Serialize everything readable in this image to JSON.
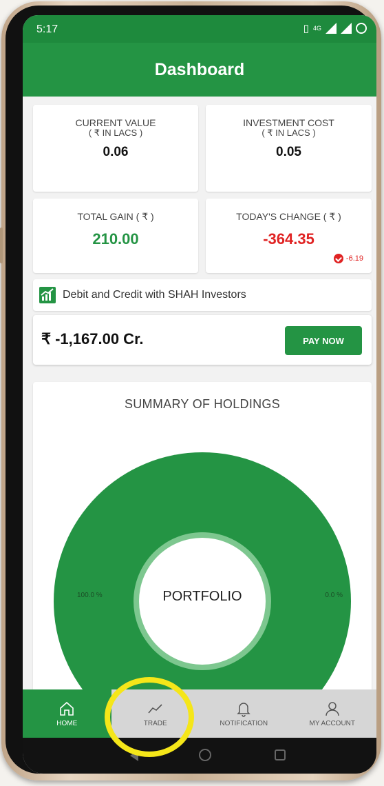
{
  "status_bar": {
    "time": "5:17",
    "network": "4G"
  },
  "header": {
    "title": "Dashboard"
  },
  "cards": {
    "current_value": {
      "label": "CURRENT VALUE",
      "sub": "( ₹ IN LACS )",
      "value": "0.06"
    },
    "investment_cost": {
      "label": "INVESTMENT COST",
      "sub": "( ₹ IN LACS )",
      "value": "0.05"
    },
    "total_gain": {
      "label": "TOTAL GAIN ( ₹ )",
      "value": "210.00"
    },
    "todays_change": {
      "label": "TODAY'S CHANGE ( ₹ )",
      "value": "-364.35",
      "change": "-6.19"
    }
  },
  "debit": {
    "text": "Debit and Credit with SHAH Investors"
  },
  "payment": {
    "balance": "₹ -1,167.00 Cr.",
    "pay_label": "PAY NOW"
  },
  "summary": {
    "title": "SUMMARY OF HOLDINGS",
    "center_label": "PORTFOLIO",
    "left_percent": "100.0 %",
    "right_percent": "0.0 %"
  },
  "nav": {
    "items": [
      {
        "label": "HOME",
        "icon": "home-icon",
        "active": true
      },
      {
        "label": "TRADE",
        "icon": "trend-icon",
        "active": false
      },
      {
        "label": "NOTIFICATION",
        "icon": "bell-icon",
        "active": false
      },
      {
        "label": "MY ACCOUNT",
        "icon": "user-icon",
        "active": false
      }
    ]
  },
  "colors": {
    "primary": "#249444",
    "negative": "#e02323",
    "highlight": "#f5e619"
  }
}
